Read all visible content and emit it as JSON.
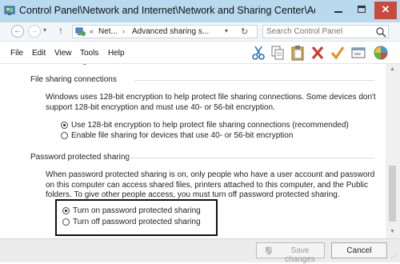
{
  "window": {
    "title": "Control Panel\\Network and Internet\\Network and Sharing Center\\Advanced...",
    "close_label": "✕"
  },
  "address": {
    "crumb1": "Net...",
    "separator": "›",
    "crumb2": "Advanced sharing s...",
    "overflow": "«",
    "refresh_glyph": "↻",
    "search_placeholder": "Search Control Panel",
    "back_glyph": "←",
    "forward_glyph": "→",
    "up_glyph": "↑",
    "dropdown_glyph": "▾"
  },
  "menu": [
    "File",
    "Edit",
    "View",
    "Tools",
    "Help"
  ],
  "toolbar_icons": [
    "cut-icon",
    "copy-icon",
    "paste-icon",
    "delete-icon",
    "checkmark-icon",
    "properties-icon",
    "globe-icon"
  ],
  "content": {
    "file_sharing": {
      "heading": "File sharing connections",
      "description": "Windows uses 128-bit encryption to help protect file sharing connections. Some devices don't support 128-bit encryption and must use 40- or 56-bit encryption.",
      "options": [
        {
          "label": "Use 128-bit encryption to help protect file sharing connections (recommended)",
          "selected": true
        },
        {
          "label": "Enable file sharing for devices that use 40- or 56-bit encryption",
          "selected": false
        }
      ]
    },
    "password_sharing": {
      "heading": "Password protected sharing",
      "description": "When password protected sharing is on, only people who have a user account and password on this computer can access shared files, printers attached to this computer, and the Public folders. To give other people access, you must turn off password protected sharing.",
      "options": [
        {
          "label": "Turn on password protected sharing",
          "selected": true
        },
        {
          "label": "Turn off password protected sharing",
          "selected": false
        }
      ]
    }
  },
  "buttons": {
    "save": "Save changes",
    "cancel": "Cancel"
  },
  "colors": {
    "titlebar": "#b9d9ee",
    "close": "#c74a3c",
    "link": "#2a6ab0"
  }
}
